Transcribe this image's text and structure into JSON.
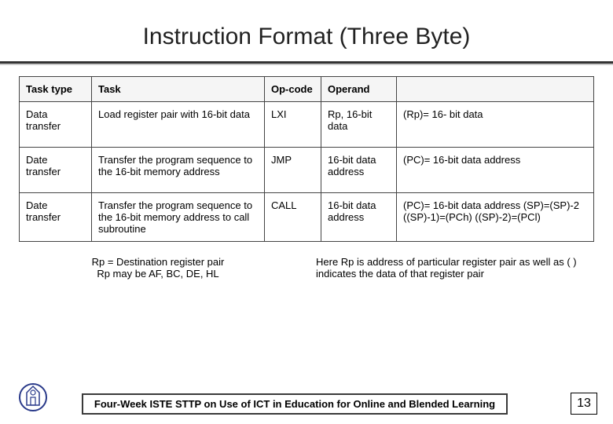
{
  "title": "Instruction Format (Three Byte)",
  "table": {
    "headers": {
      "task_type": "Task type",
      "task": "Task",
      "opcode": "Op-code",
      "operand": "Operand",
      "notes": ""
    },
    "rows": [
      {
        "task_type": "Data transfer",
        "task": "Load register pair with 16-bit data",
        "opcode": "LXI",
        "operand": "Rp, 16-bit data",
        "notes": "(Rp)= 16- bit data"
      },
      {
        "task_type": "Date transfer",
        "task": "Transfer the program sequence to the 16-bit memory address",
        "opcode": "JMP",
        "operand": "16-bit data address",
        "notes": "(PC)= 16-bit data address"
      },
      {
        "task_type": "Date transfer",
        "task": "Transfer the program sequence to the 16-bit memory address to call subroutine",
        "opcode": "CALL",
        "operand": "16-bit data address",
        "notes": "(PC)= 16-bit data address (SP)=(SP)-2 ((SP)-1)=(PCh) ((SP)-2)=(PCl)"
      }
    ]
  },
  "notes": {
    "left_line1": "Rp = Destination register pair",
    "left_line2": "Rp may be AF, BC, DE, HL",
    "right": "Here Rp is address of particular register pair as well as ( ) indicates the data of that register pair"
  },
  "footer": {
    "text": "Four-Week ISTE STTP on Use of ICT in Education for Online and Blended Learning",
    "page": "13"
  }
}
